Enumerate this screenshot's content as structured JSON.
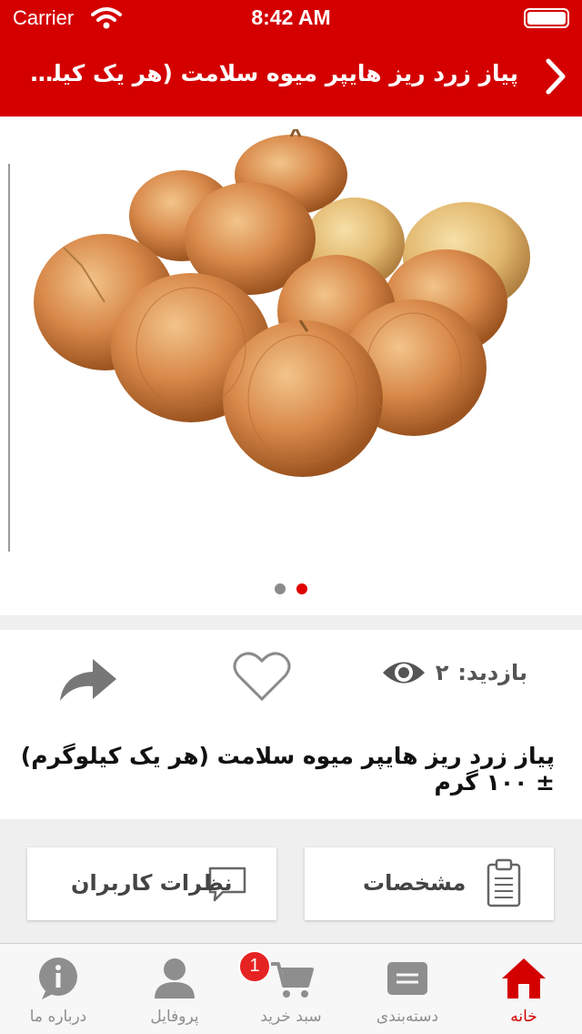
{
  "status_bar": {
    "carrier": "Carrier",
    "time": "8:42 AM"
  },
  "nav": {
    "title": "پیاز زرد ریز هایپر میوه سلامت (هر یک کیلوگرم)..."
  },
  "gallery": {
    "image": "onions-photo",
    "page_count": 2,
    "active_page": 2
  },
  "product": {
    "views_label": "بازدید:",
    "views_count": "۲",
    "title": "پیاز زرد ریز هایپر میوه سلامت (هر یک کیلوگرم) ± ۱۰۰ گرم"
  },
  "actions": {
    "specs_label": "مشخصات",
    "comments_label": "نظرات کاربران"
  },
  "tabbar": {
    "items": [
      {
        "label": "خانه",
        "icon": "home-icon",
        "active": true
      },
      {
        "label": "دسته‌بندی",
        "icon": "category-icon",
        "active": false
      },
      {
        "label": "سبد خرید",
        "icon": "cart-icon",
        "active": false,
        "badge": "1"
      },
      {
        "label": "پروفایل",
        "icon": "profile-icon",
        "active": false
      },
      {
        "label": "درباره ما",
        "icon": "info-icon",
        "active": false
      }
    ]
  },
  "colors": {
    "brand_red": "#d40000",
    "badge_red": "#e62323",
    "muted_gray": "#8e8e8e"
  }
}
